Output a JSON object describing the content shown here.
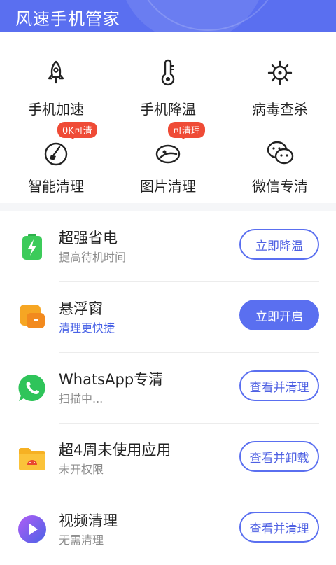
{
  "header": {
    "title": "风速手机管家"
  },
  "tools": [
    {
      "label": "手机加速",
      "icon": "rocket-icon"
    },
    {
      "label": "手机降温",
      "icon": "thermometer-icon"
    },
    {
      "label": "病毒查杀",
      "icon": "virus-icon"
    },
    {
      "label": "智能清理",
      "icon": "broom-icon",
      "badge": "0K可清"
    },
    {
      "label": "图片清理",
      "icon": "image-icon",
      "badge": "可清理"
    },
    {
      "label": "微信专清",
      "icon": "wechat-icon"
    }
  ],
  "list": [
    {
      "title": "超强省电",
      "subtitle": "提高待机时间",
      "button": "立即降温",
      "icon": "battery-icon"
    },
    {
      "title": "悬浮窗",
      "subtitle": "清理更快捷",
      "button": "立即开启",
      "icon": "floating-window-icon"
    },
    {
      "title": "WhatsApp专清",
      "subtitle": "扫描中...",
      "button": "查看并清理",
      "icon": "whatsapp-icon"
    },
    {
      "title": "超4周未使用应用",
      "subtitle": "未开权限",
      "button": "查看并卸载",
      "icon": "android-folder-icon"
    },
    {
      "title": "视频清理",
      "subtitle": "无需清理",
      "button": "查看并清理",
      "icon": "video-icon"
    }
  ],
  "colors": {
    "primary": "#5a6ff0",
    "badge": "#ef4b36",
    "battery": "#3ccb5a",
    "whatsapp": "#2fc45a",
    "folder": "#f6a623"
  }
}
